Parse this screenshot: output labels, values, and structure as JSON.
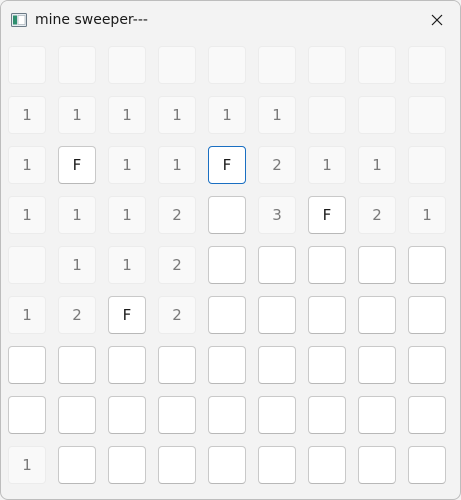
{
  "window": {
    "title": "mine sweeper---",
    "icon": "app-window-icon",
    "close_icon": "close-icon"
  },
  "board": {
    "rows": 9,
    "cols": 9,
    "focused_cell": [
      2,
      4
    ],
    "cells": [
      [
        "",
        "",
        "",
        "",
        "",
        "",
        "",
        "",
        ""
      ],
      [
        "1",
        "1",
        "1",
        "1",
        "1",
        "1",
        "",
        "",
        ""
      ],
      [
        "1",
        "F",
        "1",
        "1",
        "F",
        "2",
        "1",
        "1",
        ""
      ],
      [
        "1",
        "1",
        "1",
        "2",
        "#",
        "3",
        "F",
        "2",
        "1"
      ],
      [
        "",
        "1",
        "1",
        "2",
        "#",
        "#",
        "#",
        "#",
        "#"
      ],
      [
        "1",
        "2",
        "F",
        "2",
        "#",
        "#",
        "#",
        "#",
        "#"
      ],
      [
        "#",
        "#",
        "#",
        "#",
        "#",
        "#",
        "#",
        "#",
        "#"
      ],
      [
        "#",
        "#",
        "#",
        "#",
        "#",
        "#",
        "#",
        "#",
        "#"
      ],
      [
        "1",
        "#",
        "#",
        "#",
        "#",
        "#",
        "#",
        "#",
        "#"
      ]
    ],
    "legend": {
      "#": "unrevealed",
      "F": "flagged",
      "": "revealed-empty"
    }
  }
}
